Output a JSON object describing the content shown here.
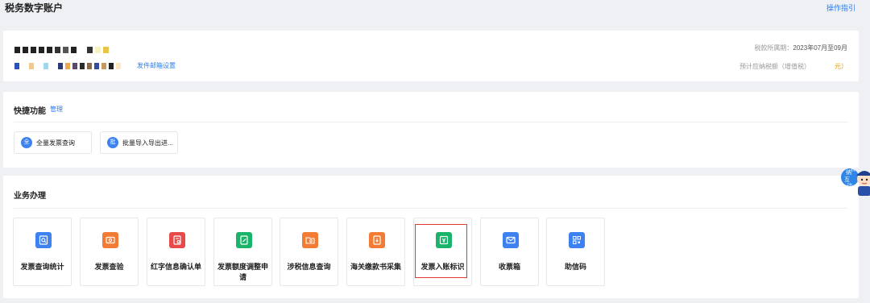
{
  "header": {
    "title": "税务数字账户",
    "guide_link": "操作指引"
  },
  "account": {
    "email_setting": "发件邮箱设置",
    "tax_period_label": "税款所属期：",
    "tax_period_value": "2023年07月至09月",
    "estimated_tax_label": "预计应纳税额（增值税）",
    "estimated_tax_unit": "元）"
  },
  "quick": {
    "title": "快捷功能",
    "manage": "管理",
    "buttons": [
      {
        "icon_text": "全",
        "label": "全量发票查询"
      },
      {
        "icon_text": "批",
        "label": "批量导入导出进..."
      }
    ]
  },
  "biz": {
    "title": "业务办理",
    "tiles": [
      {
        "label": "发票查询统计",
        "icon": "invoice-search-icon",
        "color": "#3d82f0"
      },
      {
        "label": "发票查验",
        "icon": "invoice-verify-icon",
        "color": "#f37b34"
      },
      {
        "label": "红字信息确认单",
        "icon": "red-invoice-confirm-icon",
        "color": "#e84a4a"
      },
      {
        "label": "发票额度调整申请",
        "icon": "quota-adjust-icon",
        "color": "#19b36a"
      },
      {
        "label": "涉税信息查询",
        "icon": "tax-info-query-icon",
        "color": "#f37b34"
      },
      {
        "label": "海关缴款书采集",
        "icon": "customs-payment-icon",
        "color": "#f37b34"
      },
      {
        "label": "发票入账标识",
        "icon": "invoice-booking-icon",
        "color": "#19b36a"
      },
      {
        "label": "收票箱",
        "icon": "inbox-icon",
        "color": "#3d82f0"
      },
      {
        "label": "助信码",
        "icon": "qr-code-icon",
        "color": "#3d82f0"
      }
    ]
  },
  "float_widget": {
    "icon": "assistant-avatar-icon",
    "text": "纳税互动"
  }
}
